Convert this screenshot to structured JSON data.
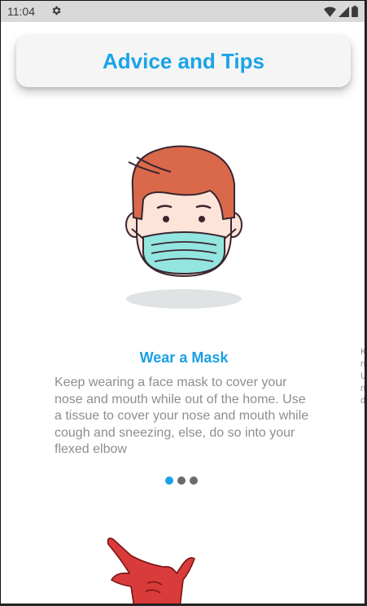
{
  "status_bar": {
    "time": "11:04",
    "icons": [
      "gear-icon",
      "wifi-icon",
      "signal-icon",
      "battery-icon"
    ]
  },
  "header": {
    "title": "Advice and Tips"
  },
  "tip": {
    "title": "Wear a Mask",
    "body": "Keep wearing a face mask to cover your nose and mouth while out of the home. Use a tissue to cover your nose and mouth while cough and sneezing, else, do so into your flexed elbow"
  },
  "pager": {
    "count": 3,
    "active_index": 0
  },
  "next_card_peek": [
    "K",
    "n",
    "U",
    "n",
    "d"
  ],
  "colors": {
    "accent": "#1aa3e8",
    "body_text": "#8e8e8e",
    "header_bg": "#f5f5f5",
    "status_bar_bg": "#d9d9d9"
  }
}
